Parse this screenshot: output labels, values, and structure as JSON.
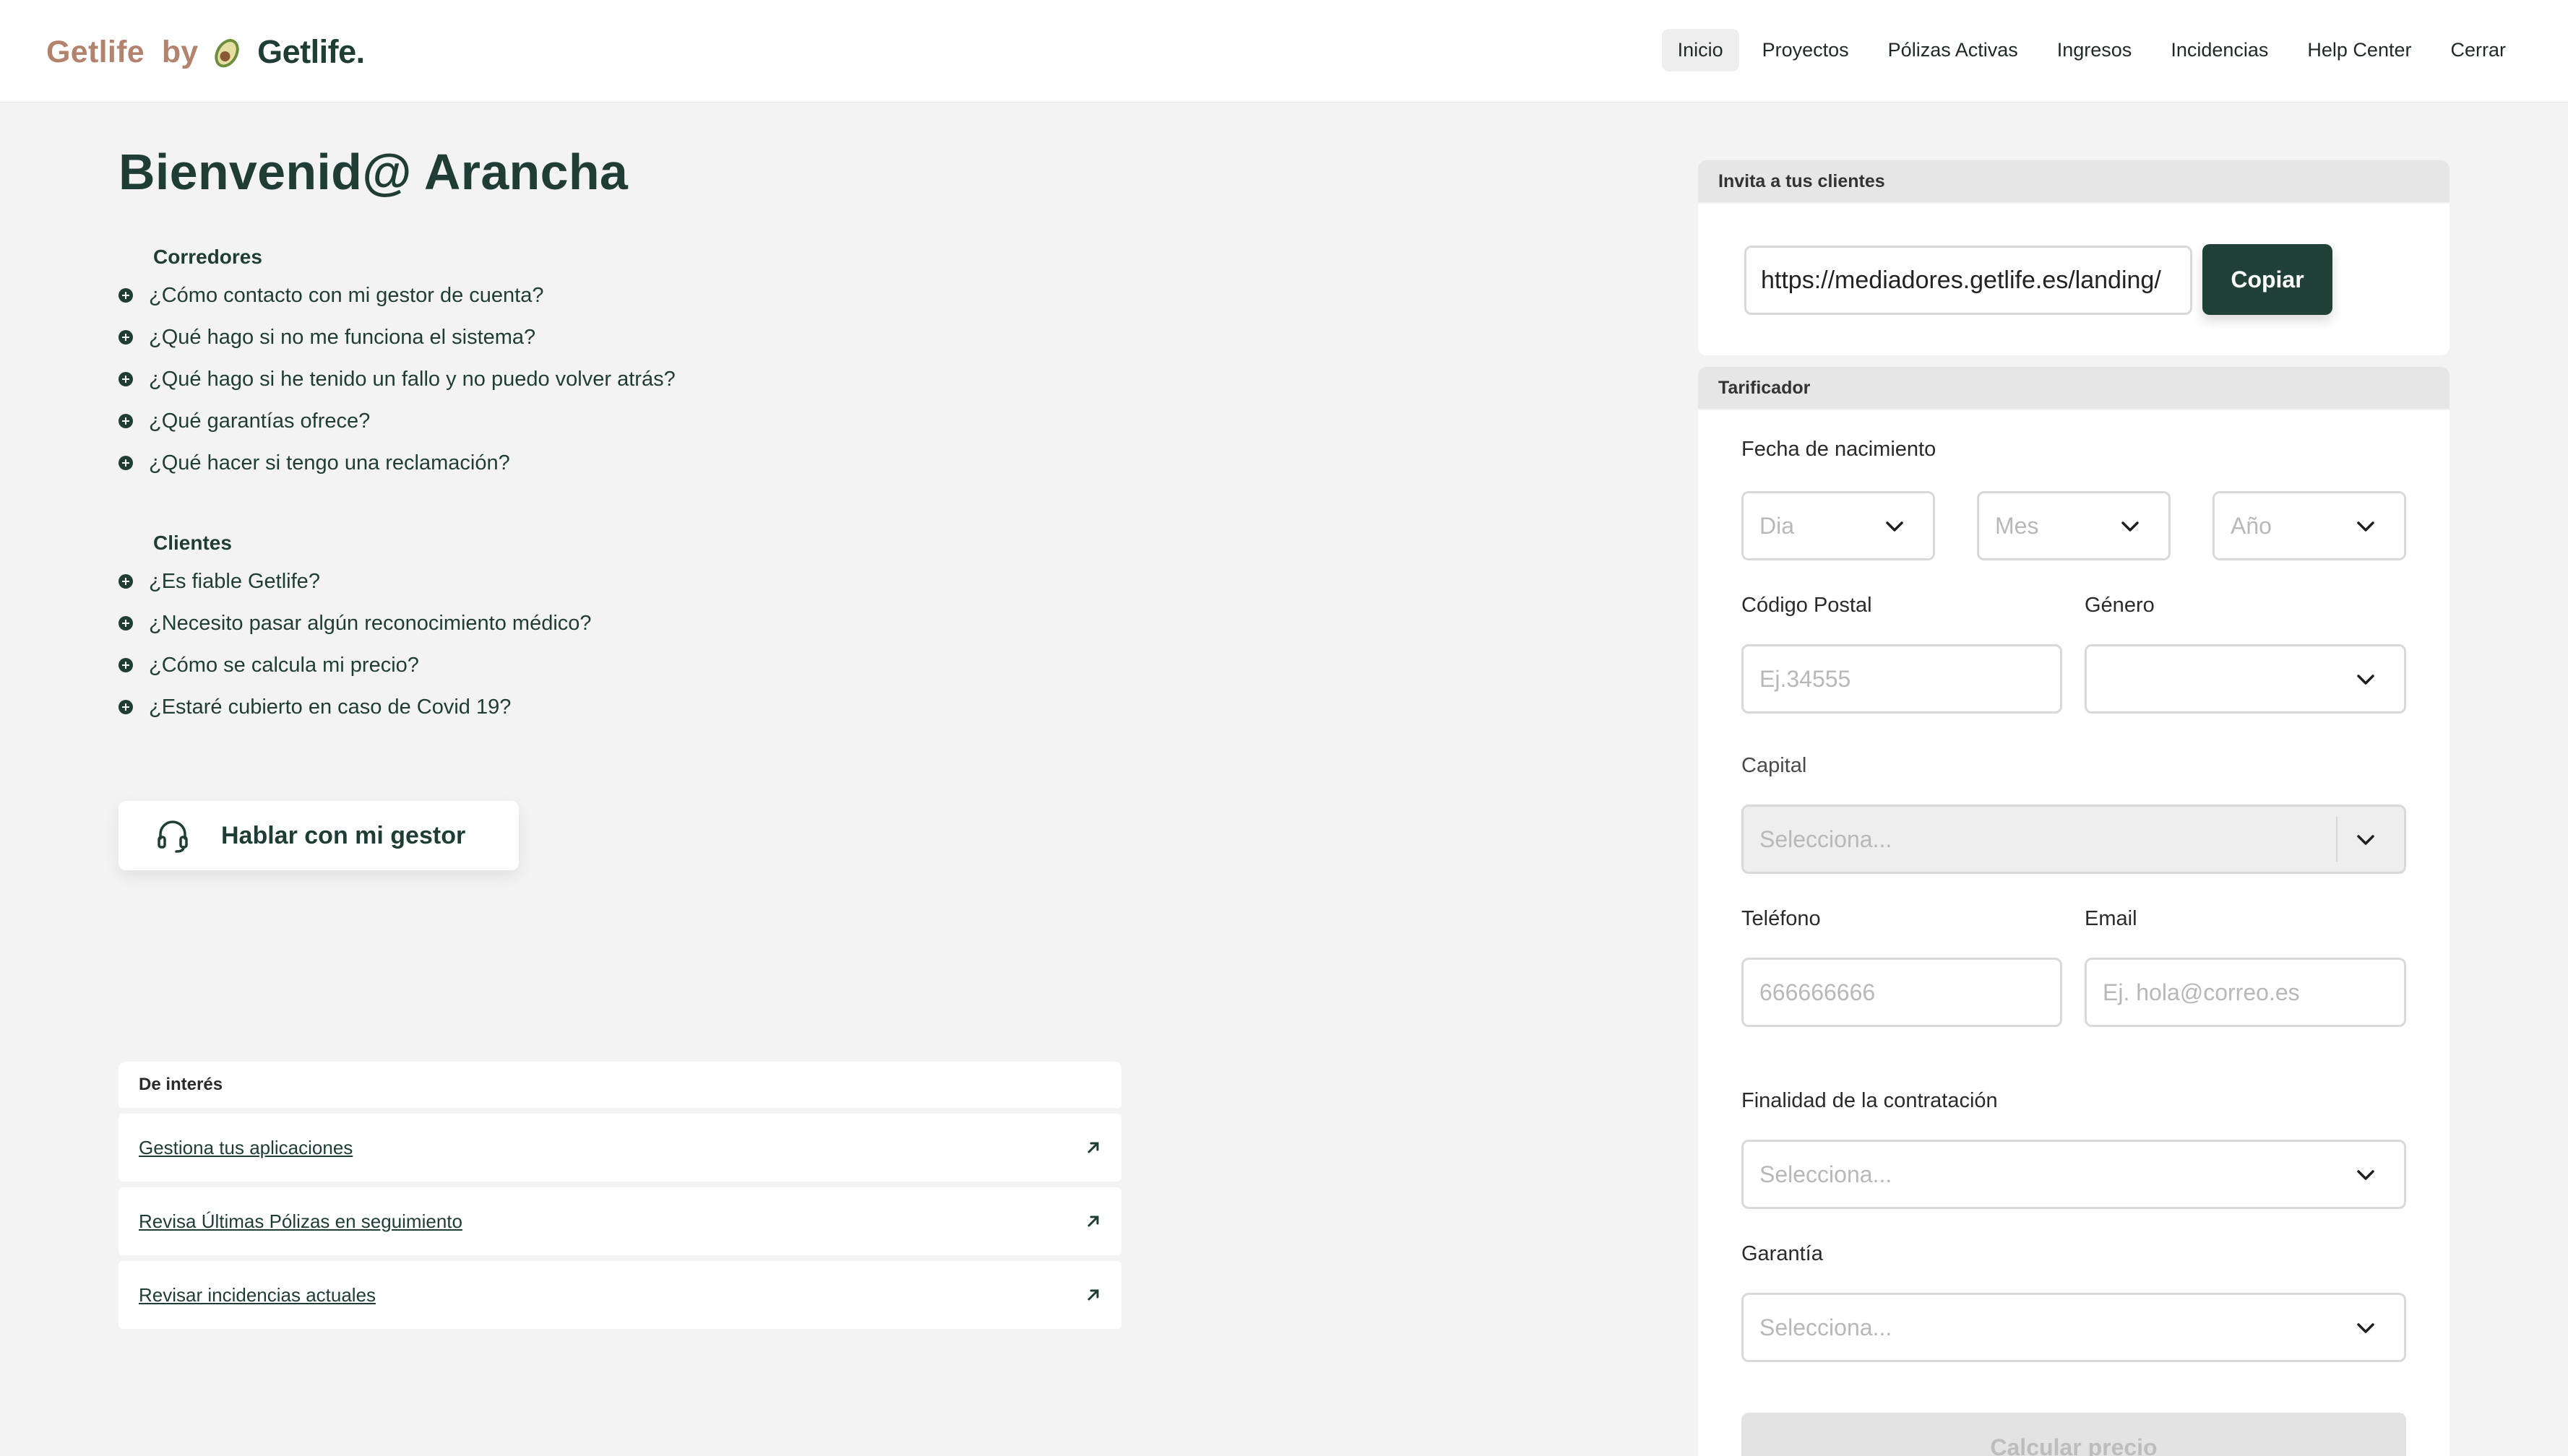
{
  "header": {
    "brand_text": "Getlife",
    "brand_by": "by",
    "brand_logo_text": "Getlife.",
    "nav": [
      {
        "label": "Inicio",
        "active": true
      },
      {
        "label": "Proyectos"
      },
      {
        "label": "Pólizas Activas"
      },
      {
        "label": "Ingresos"
      },
      {
        "label": "Incidencias"
      },
      {
        "label": "Help Center"
      },
      {
        "label": "Cerrar"
      }
    ]
  },
  "main": {
    "welcome": "Bienvenid@ Arancha",
    "faq_groups": [
      {
        "title": "Corredores",
        "items": [
          "¿Cómo contacto con mi gestor de cuenta?",
          "¿Qué hago si no me funciona el sistema?",
          "¿Qué hago si he tenido un fallo y no puedo volver atrás?",
          "¿Qué garantías ofrece?",
          "¿Qué hacer si tengo una reclamación?"
        ]
      },
      {
        "title": "Clientes",
        "items": [
          "¿Es fiable Getlife?",
          "¿Necesito pasar algún reconocimiento médico?",
          "¿Cómo se calcula mi precio?",
          "¿Estaré cubierto en caso de Covid 19?"
        ]
      }
    ],
    "gestor_button": "Hablar con mi gestor",
    "interest": {
      "title": "De interés",
      "links": [
        "Gestiona tus aplicaciones",
        "Revisa Últimas Pólizas en seguimiento",
        "Revisar incidencias actuales"
      ]
    }
  },
  "invite": {
    "title": "Invita a tus clientes",
    "url": "https://mediadores.getlife.es/landing/",
    "copy_label": "Copiar"
  },
  "tarificador": {
    "title": "Tarificador",
    "birth_label": "Fecha de nacimiento",
    "day_placeholder": "Dia",
    "month_placeholder": "Mes",
    "year_placeholder": "Año",
    "postal_label": "Código Postal",
    "postal_placeholder": "Ej.34555",
    "gender_label": "Género",
    "gender_value": "",
    "capital_label": "Capital",
    "capital_placeholder": "Selecciona...",
    "phone_label": "Teléfono",
    "phone_placeholder": "666666666",
    "email_label": "Email",
    "email_placeholder": "Ej. hola@correo.es",
    "purpose_label": "Finalidad de la contratación",
    "purpose_placeholder": "Selecciona...",
    "guarantee_label": "Garantía",
    "guarantee_placeholder": "Selecciona...",
    "calc_label": "Calcular precio"
  },
  "colors": {
    "brand_dark": "#1f3d35",
    "brand_light": "#b3836e",
    "background": "#f3f3f3"
  }
}
